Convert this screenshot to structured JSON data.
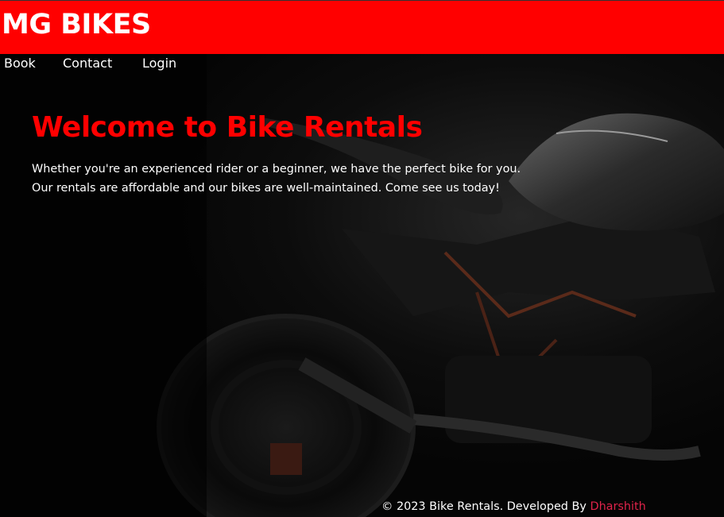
{
  "header": {
    "brand": "MG BIKES",
    "background_color": "#ff0000"
  },
  "nav": {
    "items": [
      {
        "label": "Book"
      },
      {
        "label": "Contact"
      },
      {
        "label": "Login"
      }
    ]
  },
  "hero": {
    "title": "Welcome to Bike Rentals",
    "line1": "Whether you're an experienced rider or a beginner, we have the perfect bike for you.",
    "line2": "Our rentals are affordable and our bikes are well-maintained. Come see us today!",
    "title_color": "#ff0000",
    "background_image": "motorcycle-photo"
  },
  "footer": {
    "text": "© 2023 Bike Rentals. Developed By ",
    "developer": "Dharshith",
    "developer_color": "#e0234a"
  }
}
